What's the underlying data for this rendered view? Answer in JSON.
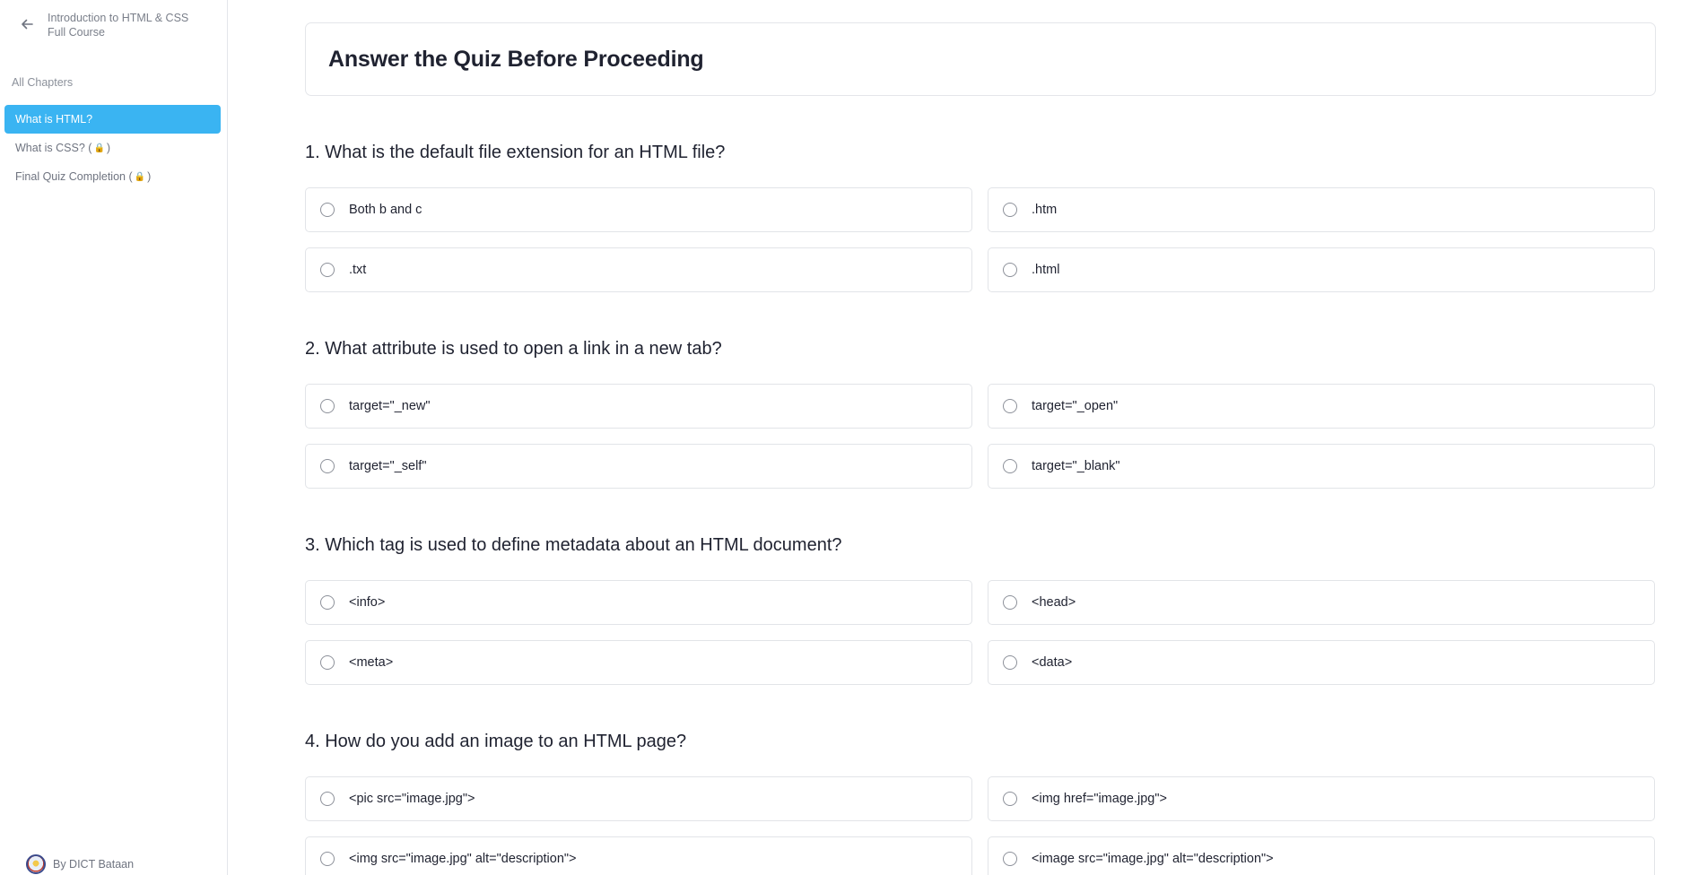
{
  "sidebar": {
    "course_title": "Introduction to HTML & CSS Full Course",
    "chapters_label": "All Chapters",
    "chapters": [
      {
        "label": "What is HTML?",
        "locked": false,
        "active": true
      },
      {
        "label": "What is CSS?",
        "locked": true,
        "active": false
      },
      {
        "label": "Final Quiz Completion",
        "locked": true,
        "active": false
      }
    ],
    "lock_icon": "🔒",
    "brand_text": "By DICT Bataan"
  },
  "quiz": {
    "title": "Answer the Quiz Before Proceeding",
    "questions": [
      {
        "text": "1. What is the default file extension for an HTML file?",
        "options": [
          "Both b and c",
          ".htm",
          ".txt",
          ".html"
        ]
      },
      {
        "text": "2. What attribute is used to open a link in a new tab?",
        "options": [
          "target=\"_new\"",
          "target=\"_open\"",
          "target=\"_self\"",
          "target=\"_blank\""
        ]
      },
      {
        "text": "3. Which tag is used to define metadata about an HTML document?",
        "options": [
          "<info>",
          "<head>",
          "<meta>",
          "<data>"
        ]
      },
      {
        "text": "4. How do you add an image to an HTML page?",
        "options": [
          "<pic src=\"image.jpg\">",
          "<img href=\"image.jpg\">",
          "<img src=\"image.jpg\" alt=\"description\">",
          "<image src=\"image.jpg\" alt=\"description\">"
        ]
      }
    ]
  },
  "colors": {
    "active_chapter_bg": "#3ab4f2",
    "border": "#e4e6ea"
  }
}
